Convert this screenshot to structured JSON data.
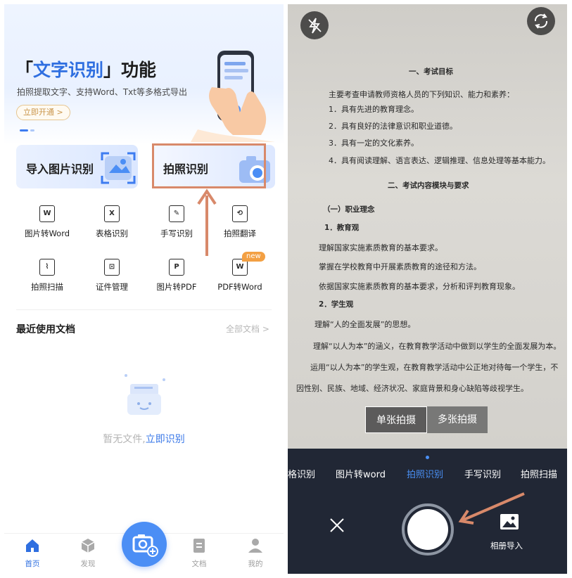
{
  "left": {
    "hero": {
      "title_pre": "「",
      "title_highlight": "文字识别",
      "title_post": "」功能",
      "subtitle": "拍照提取文字、支持Word、Txt等多格式导出",
      "open_button": "立即开通 >"
    },
    "cards": {
      "import_label": "导入图片识别",
      "photo_label": "拍照识别"
    },
    "tools": [
      {
        "label": "图片转Word",
        "icon": "word-doc-icon",
        "glyph": "W"
      },
      {
        "label": "表格识别",
        "icon": "table-doc-icon",
        "glyph": "X"
      },
      {
        "label": "手写识别",
        "icon": "feather-pen-icon",
        "glyph": "✎"
      },
      {
        "label": "拍照翻译",
        "icon": "translate-icon",
        "glyph": "⟲"
      },
      {
        "label": "拍照扫描",
        "icon": "scan-chart-icon",
        "glyph": "⌇"
      },
      {
        "label": "证件管理",
        "icon": "id-card-icon",
        "glyph": "⊡"
      },
      {
        "label": "图片转PDF",
        "icon": "pdf-doc-icon",
        "glyph": "P"
      },
      {
        "label": "PDF转Word",
        "icon": "pdf-word-icon",
        "glyph": "W",
        "badge": "new"
      }
    ],
    "recent": {
      "title": "最近使用文档",
      "all_docs": "全部文档 >"
    },
    "empty": {
      "text": "暂无文件,",
      "link": "立即识别"
    },
    "tabbar": [
      {
        "label": "首页",
        "icon": "home-icon",
        "active": true
      },
      {
        "label": "发现",
        "icon": "cube-icon",
        "active": false
      },
      {
        "label": "文档",
        "icon": "document-icon",
        "active": false
      },
      {
        "label": "我的",
        "icon": "user-icon",
        "active": false
      }
    ],
    "colors": {
      "accent": "#2f6fe0",
      "highlight_box": "#d8896a",
      "badge": "#f3a043"
    }
  },
  "right": {
    "document_lines": [
      {
        "text": "一、考试目标",
        "bold": true
      },
      {
        "text": "主要考查申请教师资格人员的下列知识、能力和素养：",
        "bold": false
      },
      {
        "text": "1．具有先进的教育理念。",
        "bold": false
      },
      {
        "text": "2．具有良好的法律意识和职业道德。",
        "bold": false
      },
      {
        "text": "3．具有一定的文化素养。",
        "bold": false
      },
      {
        "text": "4．具有阅读理解、语言表达、逻辑推理、信息处理等基本能力。",
        "bold": false
      },
      {
        "text": "二、考试内容模块与要求",
        "bold": true
      },
      {
        "text": "（一）职业理念",
        "bold": true
      },
      {
        "text": "1．教育观",
        "bold": true
      },
      {
        "text": "理解国家实施素质教育的基本要求。",
        "bold": false
      },
      {
        "text": "掌握在学校教育中开展素质教育的途径和方法。",
        "bold": false
      },
      {
        "text": "依据国家实施素质教育的基本要求，分析和评判教育现象。",
        "bold": false
      },
      {
        "text": "2．学生观",
        "bold": true
      },
      {
        "text": "理解“人的全面发展”的思想。",
        "bold": false
      },
      {
        "text": "理解“以人为本”的涵义，在教育教学活动中做到以学生的全面发展为本。",
        "bold": false
      },
      {
        "text": "运用“以人为本”的学生观，在教育教学活动中公正地对待每一个学生，不",
        "bold": false
      },
      {
        "text": "因性别、民族、地域、经济状况、家庭背景和身心缺陷等歧视学生。",
        "bold": false
      }
    ],
    "modes": {
      "single": "单张拍摄",
      "multi": "多张拍摄"
    },
    "mode_tabs": [
      {
        "label": "格识别",
        "active": false
      },
      {
        "label": "图片转word",
        "active": false
      },
      {
        "label": "拍照识别",
        "active": true
      },
      {
        "label": "手写识别",
        "active": false
      },
      {
        "label": "拍照扫描",
        "active": false
      }
    ],
    "album_label": "相册导入",
    "icons": {
      "flash": "flash-off-icon",
      "switch": "switch-camera-icon",
      "close": "close-icon",
      "album": "image-icon"
    },
    "colors": {
      "active_tab": "#4a90f5",
      "arrow": "#d8896a"
    }
  }
}
